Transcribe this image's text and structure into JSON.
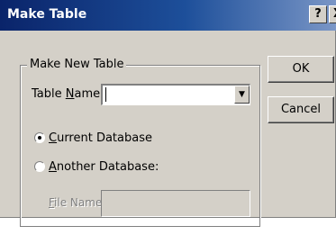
{
  "window": {
    "title": "Make Table",
    "help_glyph": "?",
    "close_glyph": "X"
  },
  "group": {
    "label": "Make New Table"
  },
  "table_name": {
    "label_prefix": "Table ",
    "label_access": "N",
    "label_suffix": "ame:",
    "value": "",
    "dropdown_glyph": "▼"
  },
  "current_db": {
    "label_access": "C",
    "label_rest": "urrent Database",
    "selected": true
  },
  "another_db": {
    "label_access": "A",
    "label_rest": "nother Database:",
    "selected": false
  },
  "file_name": {
    "label_access": "F",
    "label_rest": "ile Name:",
    "value": ""
  },
  "buttons": {
    "ok": "OK",
    "cancel": "Cancel"
  }
}
